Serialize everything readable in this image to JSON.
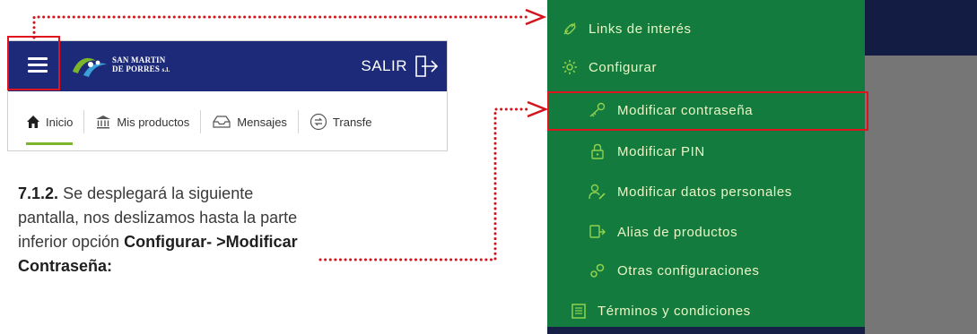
{
  "app": {
    "logo_line1": "SAN MARTIN",
    "logo_line2": "DE PORRES",
    "logo_suffix": "s.l.",
    "logout_label": "SALIR",
    "tabs": [
      {
        "label": "Inicio",
        "icon": "home-icon",
        "active": true
      },
      {
        "label": "Mis productos",
        "icon": "bank-icon",
        "active": false
      },
      {
        "label": "Mensajes",
        "icon": "inbox-icon",
        "active": false
      },
      {
        "label": "Transfe",
        "icon": "transfer-icon",
        "active": false
      }
    ]
  },
  "instruction": {
    "step": "7.1.2.",
    "text_1": "Se desplegará la siguiente pantalla, nos deslizamos hasta la parte inferior opción",
    "path": "Configurar- >Modificar Contraseña:"
  },
  "menu": {
    "items": [
      {
        "label": "Links de interés",
        "icon": "link-icon"
      },
      {
        "label": "Configurar",
        "icon": "gear-icon"
      },
      {
        "label": "Modificar contraseña",
        "icon": "key-icon"
      },
      {
        "label": "Modificar PIN",
        "icon": "lock-icon"
      },
      {
        "label": "Modificar datos personales",
        "icon": "user-edit-icon"
      },
      {
        "label": "Alias de productos",
        "icon": "tag-icon"
      },
      {
        "label": "Otras configuraciones",
        "icon": "gears-icon"
      },
      {
        "label": "Términos y condiciones",
        "icon": "document-icon"
      }
    ]
  },
  "colors": {
    "header_blue": "#1d2a7a",
    "menu_green": "#137b3d",
    "highlight_red": "#e0141e",
    "tab_active_green": "#7bb62a"
  }
}
